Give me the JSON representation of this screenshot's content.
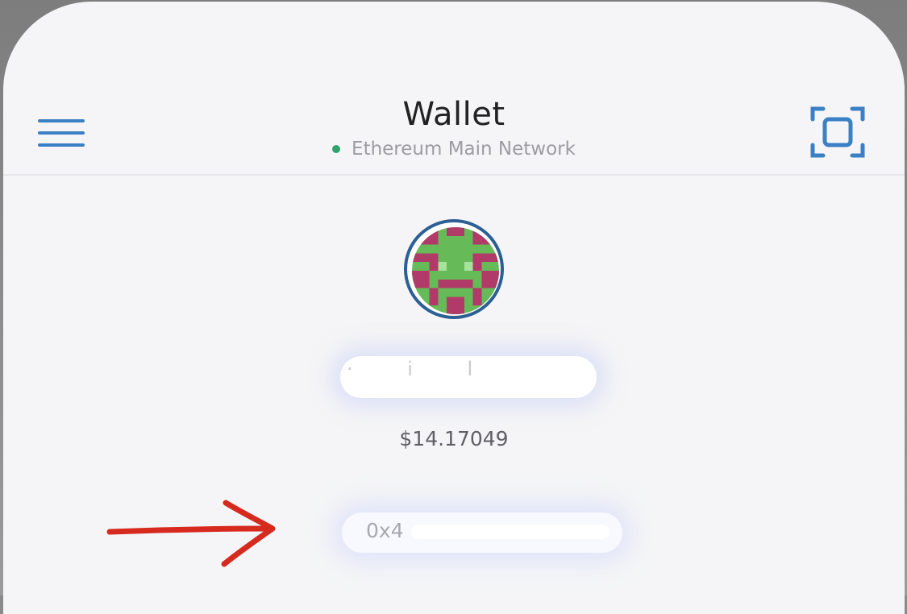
{
  "header": {
    "title": "Wallet",
    "network": "Ethereum Main Network",
    "network_status_color": "#2fa36b"
  },
  "account": {
    "name_fragment": "·  i  l",
    "balance": "$14.17049",
    "address_prefix": "0x4"
  },
  "icons": {
    "menu": "hamburger-menu-icon",
    "scan": "qr-scan-icon",
    "avatar": "identicon",
    "annotation": "red-arrow-annotation"
  },
  "colors": {
    "accent": "#3b7fc4",
    "avatar_border": "#2c5f94",
    "annotation": "#d62a1e"
  }
}
